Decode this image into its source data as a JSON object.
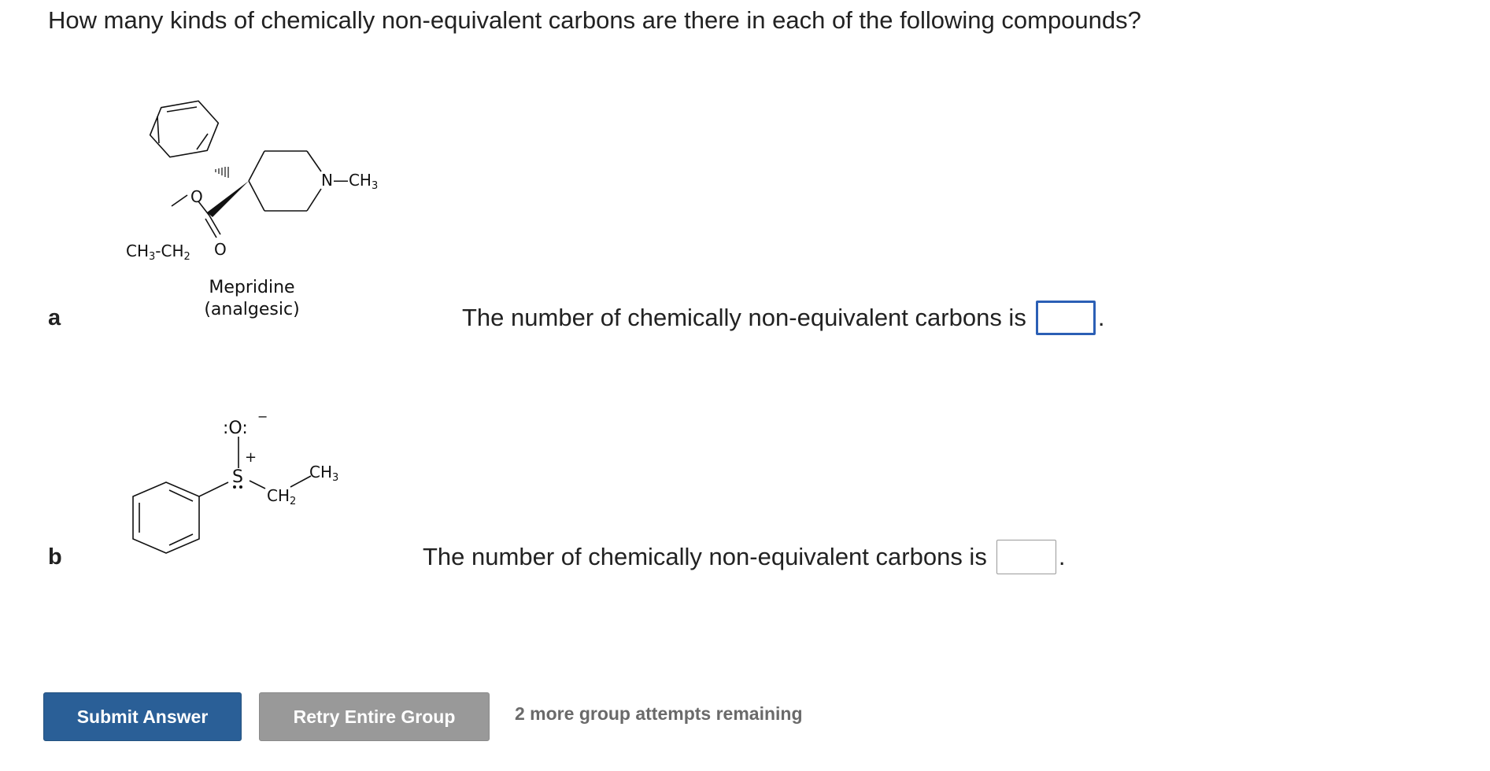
{
  "question": "How many kinds of chemically non-equivalent carbons are there in each of the following compounds?",
  "parts": [
    {
      "letter": "a",
      "molecule": {
        "labels": {
          "n_ch3": "N—CH",
          "n_ch3_sub": "3",
          "ethyl_ch3": "CH",
          "ethyl_ch3_sub": "3",
          "ethyl_ch2": "CH",
          "ethyl_ch2_sub": "2",
          "ester_o": "O",
          "carbonyl_o": "O"
        },
        "name": "Mepridine",
        "description": "(analgesic)"
      },
      "prompt": "The number of chemically non-equivalent carbons is",
      "answer_value": "",
      "suffix": "."
    },
    {
      "letter": "b",
      "molecule": {
        "labels": {
          "oxygen": ":O:",
          "charge_minus": "−",
          "charge_plus": "+",
          "sulfur": "S",
          "ch2": "CH",
          "ch2_sub": "2",
          "ch3": "CH",
          "ch3_sub": "3"
        }
      },
      "prompt": "The number of chemically non-equivalent carbons is",
      "answer_value": "",
      "suffix": "."
    }
  ],
  "buttons": {
    "submit": "Submit Answer",
    "retry": "Retry Entire Group"
  },
  "attempts_text": "2 more group attempts remaining",
  "colors": {
    "submit_bg": "#2a5f97",
    "retry_bg": "#999999",
    "focus_border": "#2b5fb5"
  }
}
